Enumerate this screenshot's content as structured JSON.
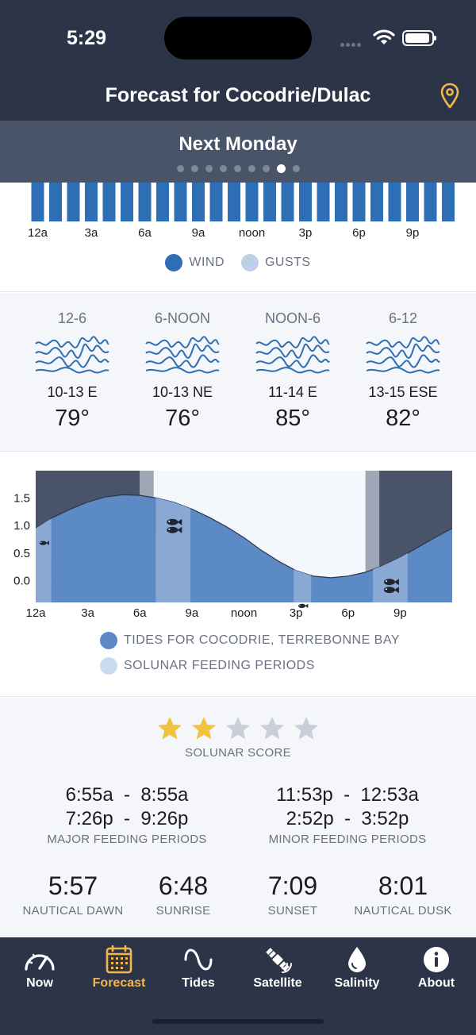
{
  "status_bar": {
    "time": "5:29"
  },
  "header": {
    "title": "Forecast for Cocodrie/Dulac",
    "location_icon": "map-pin-icon"
  },
  "day_selector": {
    "title": "Next Monday",
    "page_count": 9,
    "active_page": 7
  },
  "wind_chart": {
    "type": "bar",
    "hours": 24,
    "x_tick_labels": [
      "12a",
      "3a",
      "6a",
      "9a",
      "noon",
      "3p",
      "6p",
      "9p"
    ],
    "legend": [
      {
        "label": "WIND",
        "color": "#2e6eb5"
      },
      {
        "label": "GUSTS",
        "color": "#bdd0e6"
      }
    ]
  },
  "periods": [
    {
      "label": "12-6",
      "wind": "10-13 E",
      "temp": "79°"
    },
    {
      "label": "6-NOON",
      "wind": "10-13 NE",
      "temp": "76°"
    },
    {
      "label": "NOON-6",
      "wind": "11-14 E",
      "temp": "85°"
    },
    {
      "label": "6-12",
      "wind": "13-15 ESE",
      "temp": "82°"
    }
  ],
  "chart_data": {
    "type": "area",
    "y_tick_labels": [
      "1.5",
      "1.0",
      "0.5",
      "0.0"
    ],
    "x_tick_labels": [
      "12a",
      "3a",
      "6a",
      "9a",
      "noon",
      "3p",
      "6p",
      "9p"
    ],
    "ylim": [
      -0.4,
      2.0
    ],
    "xlim": [
      0,
      24
    ],
    "tide_x": [
      0,
      1,
      2,
      3,
      4,
      5,
      6,
      7,
      8,
      9,
      10,
      11,
      12,
      13,
      14,
      15,
      16,
      17,
      18,
      19,
      20,
      21,
      22,
      23,
      24
    ],
    "tide_y": [
      0.95,
      1.15,
      1.3,
      1.43,
      1.52,
      1.56,
      1.55,
      1.5,
      1.42,
      1.3,
      1.15,
      0.98,
      0.78,
      0.55,
      0.35,
      0.18,
      0.08,
      0.05,
      0.08,
      0.15,
      0.27,
      0.42,
      0.6,
      0.78,
      0.95
    ],
    "night_periods": [
      [
        0,
        6
      ],
      [
        19.5,
        24
      ]
    ],
    "twilight_periods": [
      [
        6,
        6.8
      ],
      [
        19,
        19.8
      ]
    ],
    "solunar_periods": [
      {
        "start": 0,
        "end": 0.9,
        "type": "minor"
      },
      {
        "start": 6.92,
        "end": 8.92,
        "type": "major"
      },
      {
        "start": 14.87,
        "end": 15.87,
        "type": "minor"
      },
      {
        "start": 19.43,
        "end": 21.43,
        "type": "major"
      }
    ],
    "legend": [
      {
        "label": "TIDES FOR COCODRIE, TERREBONNE BAY",
        "color": "#5b8ac4"
      },
      {
        "label": "SOLUNAR FEEDING PERIODS",
        "color": "#c9dcef"
      }
    ],
    "colors": {
      "tide": "#5b8ac4",
      "night": "#4a5468",
      "twilight": "#9ea7b5",
      "day": "#f4f7fb",
      "solunar": "#89a9d4"
    }
  },
  "solunar": {
    "score": 2,
    "max_score": 5,
    "score_label": "SOLUNAR SCORE",
    "major": {
      "lines": [
        "6:55a  -  8:55a",
        "7:26p  -  9:26p"
      ],
      "label": "MAJOR FEEDING PERIODS"
    },
    "minor": {
      "lines": [
        "11:53p  -  12:53a",
        "2:52p  -  3:52p"
      ],
      "label": "MINOR FEEDING PERIODS"
    },
    "sun": [
      {
        "time": "5:57",
        "label": "NAUTICAL DAWN"
      },
      {
        "time": "6:48",
        "label": "SUNRISE"
      },
      {
        "time": "7:09",
        "label": "SUNSET"
      },
      {
        "time": "8:01",
        "label": "NAUTICAL DUSK"
      }
    ]
  },
  "tabs": [
    {
      "label": "Now",
      "icon": "speedometer-icon",
      "active": false
    },
    {
      "label": "Forecast",
      "icon": "calendar-icon",
      "active": true
    },
    {
      "label": "Tides",
      "icon": "sine-wave-icon",
      "active": false
    },
    {
      "label": "Satellite",
      "icon": "satellite-icon",
      "active": false
    },
    {
      "label": "Salinity",
      "icon": "water-drop-icon",
      "active": false
    },
    {
      "label": "About",
      "icon": "info-icon",
      "active": false
    }
  ]
}
